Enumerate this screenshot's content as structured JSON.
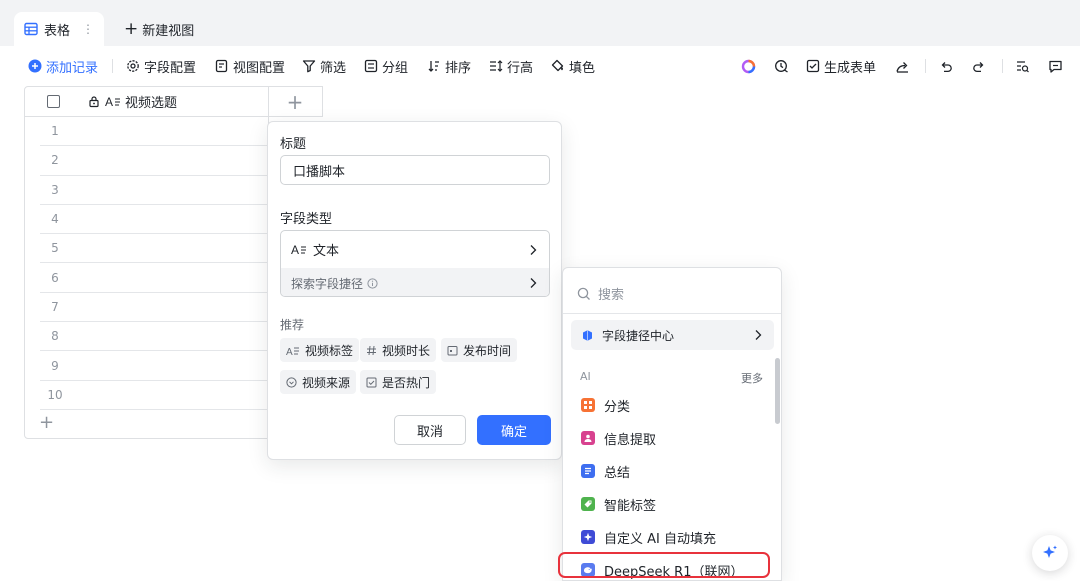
{
  "tabs": {
    "active_label": "表格",
    "more": "⋮",
    "new_view": "新建视图"
  },
  "toolbar": {
    "add_record": "添加记录",
    "field_config": "字段配置",
    "view_config": "视图配置",
    "filter": "筛选",
    "group": "分组",
    "sort": "排序",
    "row_height": "行高",
    "fill_color": "填色",
    "generate_form": "生成表单"
  },
  "grid": {
    "column_header": "视频选题",
    "rows": [
      "1",
      "2",
      "3",
      "4",
      "5",
      "6",
      "7",
      "8",
      "9",
      "10"
    ]
  },
  "field_panel": {
    "title_label": "标题",
    "title_value": "口播脚本",
    "type_label": "字段类型",
    "type_value": "文本",
    "explore_label": "探索字段捷径",
    "recommend_label": "推荐",
    "chips": [
      "视频标签",
      "视频时长",
      "发布时间",
      "视频来源",
      "是否热门"
    ],
    "cancel": "取消",
    "confirm": "确定"
  },
  "dropdown": {
    "search_placeholder": "搜索",
    "shortcut_center": "字段捷径中心",
    "section": "AI",
    "more": "更多",
    "items": [
      "分类",
      "信息提取",
      "总结",
      "智能标签",
      "自定义 AI 自动填充",
      "DeepSeek R1（联网）"
    ]
  },
  "colors": {
    "accent": "#3370ff",
    "highlight": "#e8323c",
    "ai_orange": "#f77234",
    "ai_pink": "#d8428f",
    "ai_blue": "#3e6ef0",
    "ai_green": "#4fb34e",
    "ai_indigo": "#3f4bd6",
    "ai_deepseek": "#5a7bef"
  }
}
